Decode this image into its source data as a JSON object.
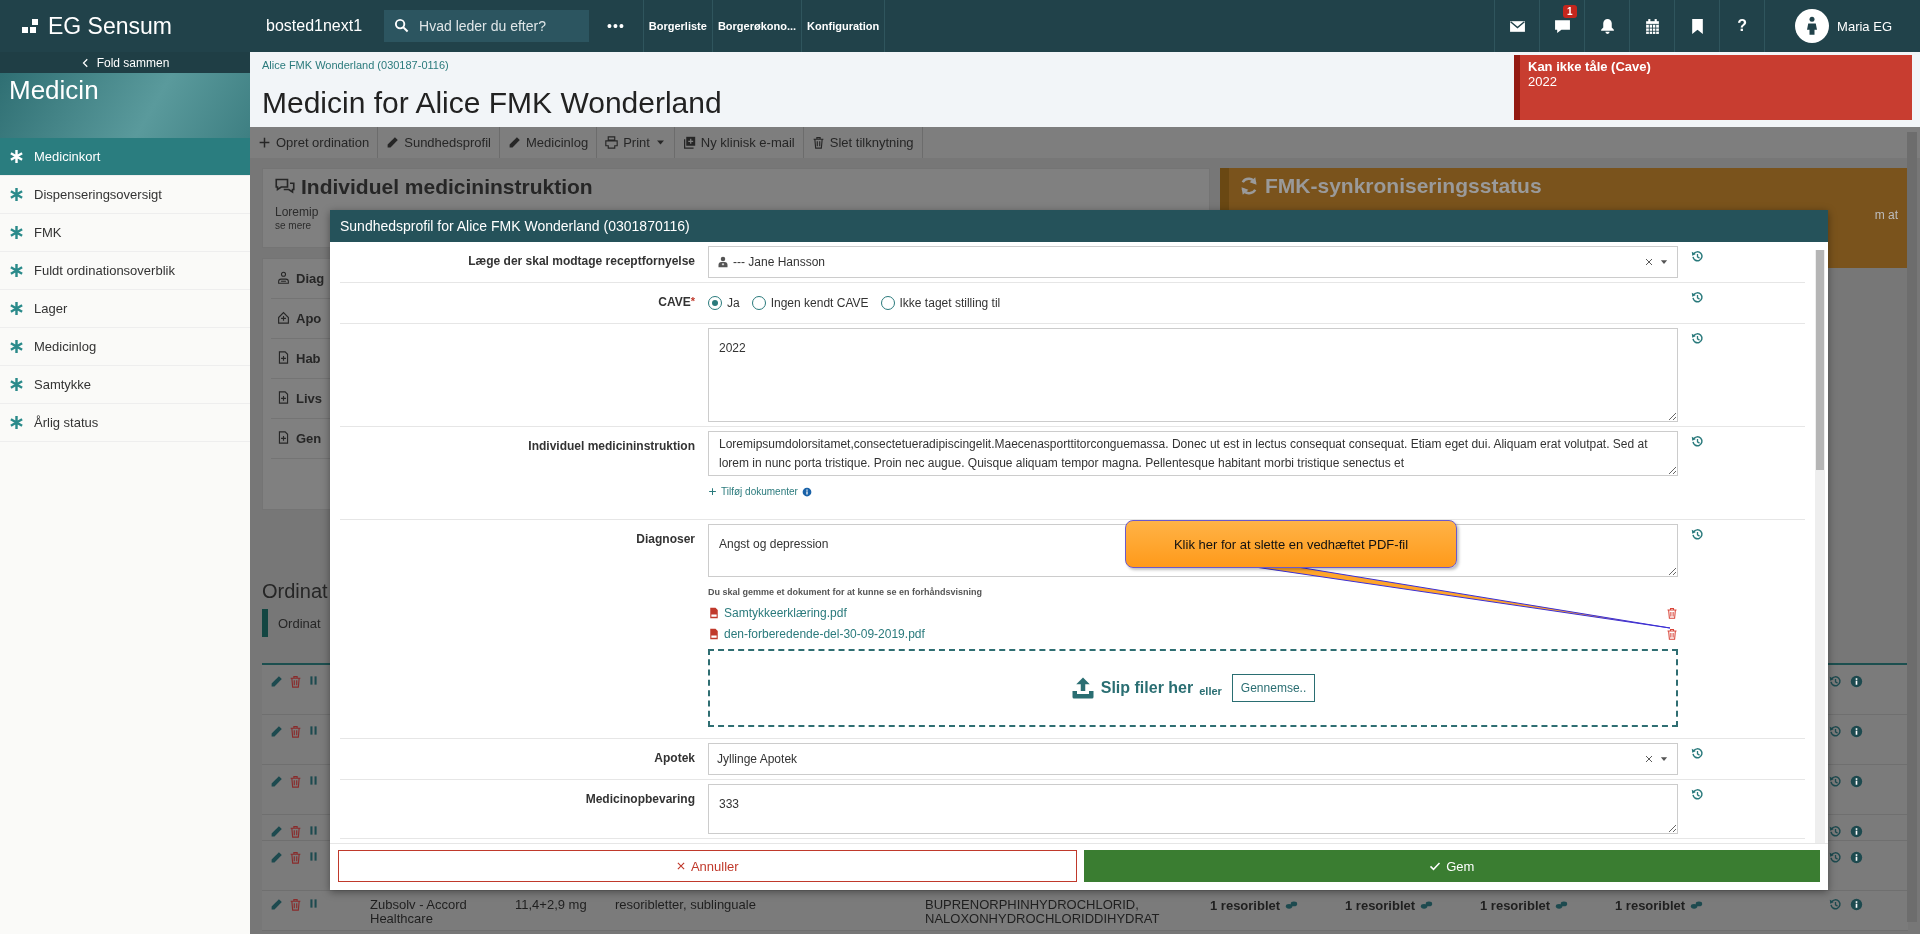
{
  "topbar": {
    "logo": "EG Sensum",
    "site": "bosted1next1",
    "search": {
      "placeholder": "Hvad leder du efter?"
    },
    "more": "•••",
    "nav": [
      "Borgerliste",
      "Borgerøkono...",
      "Konfiguration"
    ],
    "icons": [
      {
        "kind": "mail"
      },
      {
        "kind": "chat",
        "badge": "1"
      },
      {
        "kind": "bell"
      },
      {
        "kind": "calendar"
      },
      {
        "kind": "bookmark"
      },
      {
        "kind": "help",
        "label": "?"
      }
    ],
    "user": "Maria EG"
  },
  "sidebar": {
    "collapse": "Fold sammen",
    "title": "Medicin",
    "items": [
      {
        "label": "Medicinkort",
        "selected": true
      },
      {
        "label": "Dispenseringsoversigt",
        "selected": false
      },
      {
        "label": "FMK",
        "selected": false
      },
      {
        "label": "Fuldt ordinationsoverblik",
        "selected": false
      },
      {
        "label": "Lager",
        "selected": false
      },
      {
        "label": "Medicinlog",
        "selected": false
      },
      {
        "label": "Samtykke",
        "selected": false
      },
      {
        "label": "Årlig status",
        "selected": false
      }
    ]
  },
  "header": {
    "breadcrumb": "Alice FMK Wonderland (030187-0116)",
    "title": "Medicin for Alice FMK Wonderland",
    "alert": {
      "title": "Kan ikke tåle (Cave)",
      "text": "2022"
    }
  },
  "toolbar": [
    {
      "kind": "plus",
      "label": "Opret ordination"
    },
    {
      "kind": "pencil",
      "label": "Sundhedsprofil"
    },
    {
      "kind": "pencil",
      "label": "Medicinlog"
    },
    {
      "kind": "print",
      "label": "Print"
    },
    {
      "kind": "mail-plus",
      "label": "Ny klinisk e-mail"
    },
    {
      "kind": "trash",
      "label": "Slet tilknytning"
    }
  ],
  "background": {
    "card_title": "Individuel medicininstruktion",
    "card_text": "Loremip",
    "card_link": "se mere",
    "sections": [
      {
        "kind": "person",
        "label": "Diag"
      },
      {
        "kind": "house",
        "label": "Apo"
      },
      {
        "kind": "doc",
        "label": "Hab"
      },
      {
        "kind": "doc",
        "label": "Livs"
      },
      {
        "kind": "doc",
        "label": "Gen"
      }
    ],
    "fmk_title": "FMK-synkroniseringsstatus",
    "fmk_text": "m at",
    "orders_heading": "Ordinat",
    "orders_tab": "Ordinat",
    "rows": [
      {
        "kind": "partial"
      },
      {
        "kind": "partial"
      },
      {
        "kind": "partial"
      },
      {
        "kind": "thin"
      },
      {
        "kind": "partial"
      },
      {
        "kind": "full",
        "name": "Zubsolv - Accord Healthcare",
        "strength": "11,4+2,9 mg",
        "form": "resoribletter, sublinguale",
        "substance": "BUPRENORPHINHYDROCHLORID, NALOXONHYDROCHLORIDDIHYDRAT",
        "doses": [
          "1 resoriblet",
          "1 resoriblet",
          "1 resoriblet",
          "1 resoriblet"
        ]
      }
    ]
  },
  "modal": {
    "title": "Sundhedsprofil for Alice FMK Wonderland (0301870116)",
    "fields": [
      {
        "kind": "select",
        "label": "Læge der skal modtage receptfornyelse",
        "value": "--- Jane Hansson",
        "person_icon": true
      },
      {
        "kind": "radio",
        "label": "CAVE",
        "required_mark": "*",
        "options": [
          {
            "label": "Ja",
            "selected": true
          },
          {
            "label": "Ingen kendt CAVE",
            "selected": false
          },
          {
            "label": "Ikke taget stilling til",
            "selected": false
          }
        ]
      },
      {
        "kind": "textarea",
        "value": "2022"
      },
      {
        "kind": "textarea",
        "label": "Individuel medicininstruktion",
        "value": "Loremipsumdolorsitamet,consectetueradipiscingelit.Maecenasporttitorconguemassa. Donec ut est in lectus consequat consequat. Etiam eget dui. Aliquam erat volutpat. Sed at lorem in nunc porta tristique. Proin nec augue. Quisque aliquam tempor magna. Pellentesque habitant morbi tristique senectus et",
        "add_link": "Tilføj dokumenter"
      },
      {
        "kind": "files",
        "label": "Diagnoser",
        "value": "Angst og depression",
        "hint": "Du skal gemme et dokument for at kunne se en forhåndsvisning",
        "files": [
          "Samtykkeerklæring.pdf",
          "den-forberedende-del-30-09-2019.pdf"
        ],
        "drop_text": "Slip filer her",
        "drop_or": "eller",
        "browse": "Gennemse.."
      },
      {
        "kind": "select",
        "label": "Apotek",
        "value": "Jyllinge Apotek",
        "person_icon": false
      },
      {
        "kind": "textarea",
        "label": "Medicinopbevaring",
        "value": "333"
      }
    ],
    "callout": "Klik her for at slette en vedhæftet PDF-fil",
    "cancel": "Annuller",
    "save": "Gem"
  }
}
